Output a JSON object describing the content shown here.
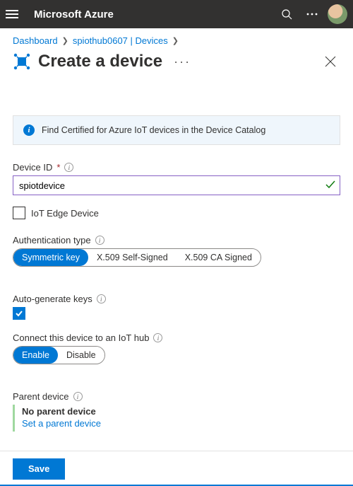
{
  "top": {
    "brand": "Microsoft Azure"
  },
  "breadcrumb": {
    "dashboard": "Dashboard",
    "hub": "spiothub0607 | Devices"
  },
  "page": {
    "title": "Create a device"
  },
  "banner": {
    "text": "Find Certified for Azure IoT devices in the Device Catalog"
  },
  "device_id": {
    "label": "Device ID",
    "value": "spiotdevice"
  },
  "iot_edge": {
    "label": "IoT Edge Device"
  },
  "auth": {
    "label": "Authentication type",
    "options": {
      "sym": "Symmetric key",
      "self": "X.509 Self-Signed",
      "ca": "X.509 CA Signed"
    }
  },
  "autogen": {
    "label": "Auto-generate keys"
  },
  "connect": {
    "label": "Connect this device to an IoT hub",
    "enable": "Enable",
    "disable": "Disable"
  },
  "parent": {
    "label": "Parent device",
    "none": "No parent device",
    "link": "Set a parent device"
  },
  "footer": {
    "save": "Save"
  }
}
